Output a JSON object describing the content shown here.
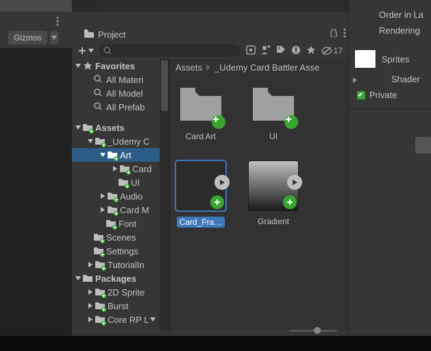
{
  "scene": {
    "gizmos_label": "Gizmos"
  },
  "project": {
    "tab_label": "Project",
    "visible_count": "17",
    "breadcrumb": [
      "Assets",
      "_Udemy Card Battler Asse"
    ]
  },
  "tree": {
    "favorites": {
      "label": "Favorites",
      "items": [
        "All Materi",
        "All Model",
        "All Prefab"
      ]
    },
    "assets": {
      "label": "Assets",
      "items": [
        {
          "label": "_Udemy C",
          "depth": 1,
          "expanded": true,
          "green": true
        },
        {
          "label": "Art",
          "depth": 2,
          "expanded": true,
          "green": true,
          "selected": true
        },
        {
          "label": "Card",
          "depth": 3,
          "expanded": false,
          "green": true
        },
        {
          "label": "UI",
          "depth": 3,
          "expanded": false,
          "green": true
        },
        {
          "label": "Audio",
          "depth": 2,
          "expanded": false,
          "green": true
        },
        {
          "label": "Card M",
          "depth": 2,
          "expanded": false,
          "green": true
        },
        {
          "label": "Font",
          "depth": 2,
          "expanded": false,
          "green": true
        },
        {
          "label": "Scenes",
          "depth": 1,
          "expanded": false,
          "green": true
        },
        {
          "label": "Settings",
          "depth": 1,
          "expanded": false,
          "green": true
        },
        {
          "label": "TutorialIn",
          "depth": 1,
          "expanded": false,
          "green": true
        }
      ]
    },
    "packages": {
      "label": "Packages",
      "items": [
        {
          "label": "2D Sprite",
          "green": true
        },
        {
          "label": "Burst",
          "green": true
        },
        {
          "label": "Core RP L",
          "green": true
        }
      ]
    }
  },
  "grid": {
    "items": [
      {
        "label": "Card Art",
        "kind": "folder"
      },
      {
        "label": "UI",
        "kind": "folder"
      },
      {
        "label": "Card_Fra…",
        "kind": "sprite",
        "selected": true
      },
      {
        "label": "Gradient",
        "kind": "gradient"
      }
    ]
  },
  "inspector": {
    "order_label": "Order in La",
    "rendering_label": "Rendering",
    "sprites_label": "Sprites",
    "shader_label": "Shader",
    "private_label": "Private"
  },
  "icons": {
    "search": "search-icon",
    "gear": "gear-icon",
    "lock": "lock-icon",
    "kebab": "kebab-icon",
    "plus": "plus-icon",
    "star": "star-icon",
    "folder": "folder-icon",
    "tag": "tag-icon",
    "alert": "alert-icon",
    "eye": "visibility-icon"
  }
}
